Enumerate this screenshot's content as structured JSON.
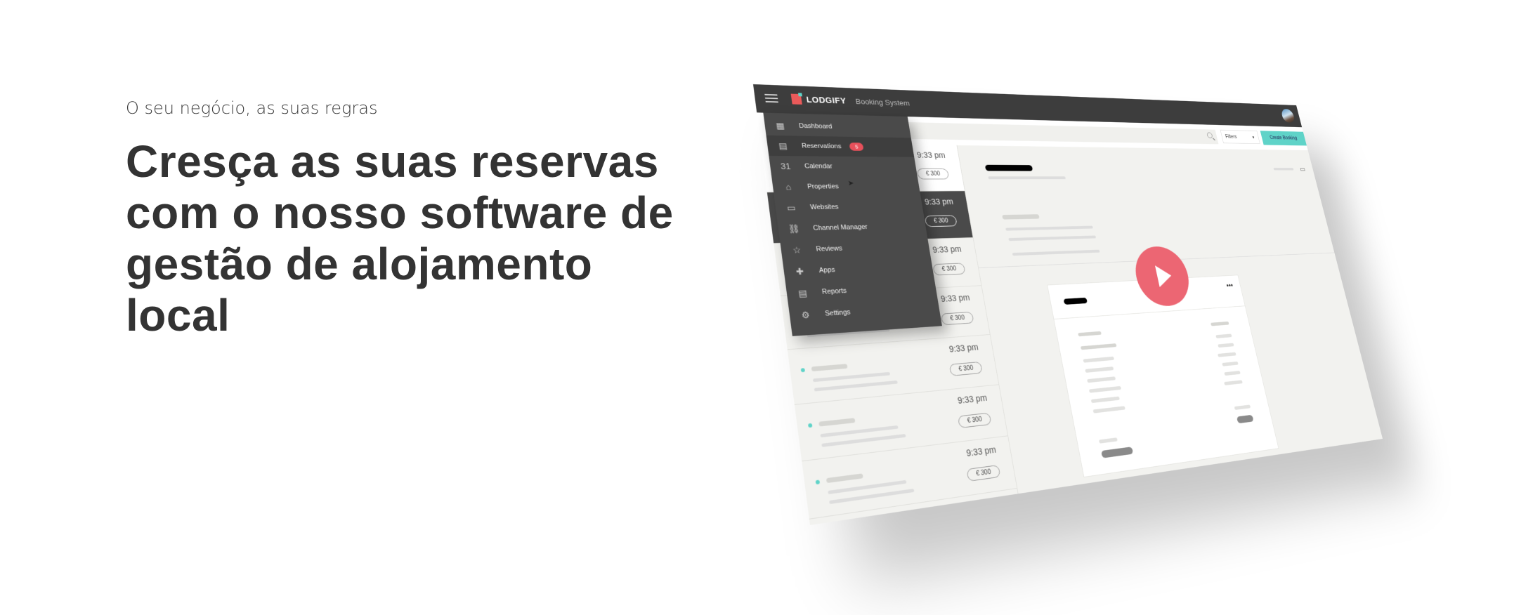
{
  "hero": {
    "eyebrow": "O seu negócio, as suas regras",
    "headline": [
      "Cresça as suas reservas",
      "com o nosso software de",
      "gestão de alojamento",
      "local"
    ]
  },
  "app": {
    "brand": "LODGIFY",
    "product": "Booking System",
    "filters_label": "Filters",
    "create_label": "Create Booking",
    "menu": [
      {
        "label": "Dashboard",
        "icon": "grid-icon",
        "glyph": "▦"
      },
      {
        "label": "Reservations",
        "icon": "clipboard-user-icon",
        "glyph": "▤",
        "badge": "5"
      },
      {
        "label": "Calendar",
        "icon": "calendar-icon",
        "glyph": "31"
      },
      {
        "label": "Properties",
        "icon": "house-icon",
        "glyph": "⌂"
      },
      {
        "label": "Websites",
        "icon": "browser-window-icon",
        "glyph": "▭"
      },
      {
        "label": "Channel Manager",
        "icon": "link-icon",
        "glyph": "⛓"
      },
      {
        "label": "Reviews",
        "icon": "star-icon",
        "glyph": "☆"
      },
      {
        "label": "Apps",
        "icon": "puzzle-icon",
        "glyph": "✚"
      },
      {
        "label": "Reports",
        "icon": "report-icon",
        "glyph": "▤"
      },
      {
        "label": "Settings",
        "icon": "gear-icon",
        "glyph": "⚙"
      }
    ],
    "bookings": [
      {
        "time": "9:33 pm",
        "price": "€ 300"
      },
      {
        "time": "9:33 pm",
        "price": "€ 300"
      },
      {
        "time": "9:33 pm",
        "price": "€ 300"
      },
      {
        "time": "9:33 pm",
        "price": "€ 300"
      },
      {
        "time": "9:33 pm",
        "price": "€ 300"
      },
      {
        "time": "9:33 pm",
        "price": "€ 300"
      },
      {
        "time": "9:33 pm",
        "price": "€ 300"
      }
    ],
    "colors": {
      "accent": "#5fd3c8",
      "badge": "#e8505b",
      "play": "#ec6673",
      "header": "#3d3d3d"
    }
  }
}
